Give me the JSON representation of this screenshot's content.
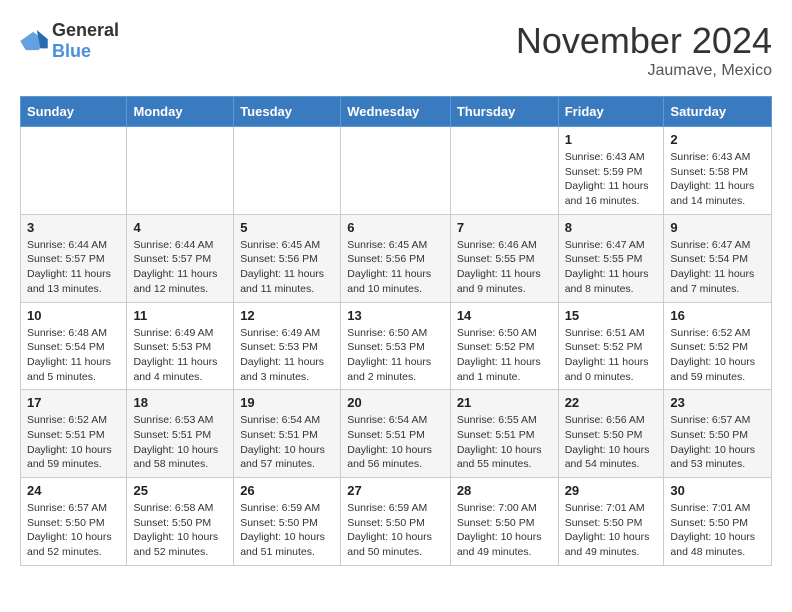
{
  "header": {
    "logo_general": "General",
    "logo_blue": "Blue",
    "month_title": "November 2024",
    "location": "Jaumave, Mexico"
  },
  "days_of_week": [
    "Sunday",
    "Monday",
    "Tuesday",
    "Wednesday",
    "Thursday",
    "Friday",
    "Saturday"
  ],
  "weeks": [
    [
      {
        "day": "",
        "info": ""
      },
      {
        "day": "",
        "info": ""
      },
      {
        "day": "",
        "info": ""
      },
      {
        "day": "",
        "info": ""
      },
      {
        "day": "",
        "info": ""
      },
      {
        "day": "1",
        "info": "Sunrise: 6:43 AM\nSunset: 5:59 PM\nDaylight: 11 hours\nand 16 minutes."
      },
      {
        "day": "2",
        "info": "Sunrise: 6:43 AM\nSunset: 5:58 PM\nDaylight: 11 hours\nand 14 minutes."
      }
    ],
    [
      {
        "day": "3",
        "info": "Sunrise: 6:44 AM\nSunset: 5:57 PM\nDaylight: 11 hours\nand 13 minutes."
      },
      {
        "day": "4",
        "info": "Sunrise: 6:44 AM\nSunset: 5:57 PM\nDaylight: 11 hours\nand 12 minutes."
      },
      {
        "day": "5",
        "info": "Sunrise: 6:45 AM\nSunset: 5:56 PM\nDaylight: 11 hours\nand 11 minutes."
      },
      {
        "day": "6",
        "info": "Sunrise: 6:45 AM\nSunset: 5:56 PM\nDaylight: 11 hours\nand 10 minutes."
      },
      {
        "day": "7",
        "info": "Sunrise: 6:46 AM\nSunset: 5:55 PM\nDaylight: 11 hours\nand 9 minutes."
      },
      {
        "day": "8",
        "info": "Sunrise: 6:47 AM\nSunset: 5:55 PM\nDaylight: 11 hours\nand 8 minutes."
      },
      {
        "day": "9",
        "info": "Sunrise: 6:47 AM\nSunset: 5:54 PM\nDaylight: 11 hours\nand 7 minutes."
      }
    ],
    [
      {
        "day": "10",
        "info": "Sunrise: 6:48 AM\nSunset: 5:54 PM\nDaylight: 11 hours\nand 5 minutes."
      },
      {
        "day": "11",
        "info": "Sunrise: 6:49 AM\nSunset: 5:53 PM\nDaylight: 11 hours\nand 4 minutes."
      },
      {
        "day": "12",
        "info": "Sunrise: 6:49 AM\nSunset: 5:53 PM\nDaylight: 11 hours\nand 3 minutes."
      },
      {
        "day": "13",
        "info": "Sunrise: 6:50 AM\nSunset: 5:53 PM\nDaylight: 11 hours\nand 2 minutes."
      },
      {
        "day": "14",
        "info": "Sunrise: 6:50 AM\nSunset: 5:52 PM\nDaylight: 11 hours\nand 1 minute."
      },
      {
        "day": "15",
        "info": "Sunrise: 6:51 AM\nSunset: 5:52 PM\nDaylight: 11 hours\nand 0 minutes."
      },
      {
        "day": "16",
        "info": "Sunrise: 6:52 AM\nSunset: 5:52 PM\nDaylight: 10 hours\nand 59 minutes."
      }
    ],
    [
      {
        "day": "17",
        "info": "Sunrise: 6:52 AM\nSunset: 5:51 PM\nDaylight: 10 hours\nand 59 minutes."
      },
      {
        "day": "18",
        "info": "Sunrise: 6:53 AM\nSunset: 5:51 PM\nDaylight: 10 hours\nand 58 minutes."
      },
      {
        "day": "19",
        "info": "Sunrise: 6:54 AM\nSunset: 5:51 PM\nDaylight: 10 hours\nand 57 minutes."
      },
      {
        "day": "20",
        "info": "Sunrise: 6:54 AM\nSunset: 5:51 PM\nDaylight: 10 hours\nand 56 minutes."
      },
      {
        "day": "21",
        "info": "Sunrise: 6:55 AM\nSunset: 5:51 PM\nDaylight: 10 hours\nand 55 minutes."
      },
      {
        "day": "22",
        "info": "Sunrise: 6:56 AM\nSunset: 5:50 PM\nDaylight: 10 hours\nand 54 minutes."
      },
      {
        "day": "23",
        "info": "Sunrise: 6:57 AM\nSunset: 5:50 PM\nDaylight: 10 hours\nand 53 minutes."
      }
    ],
    [
      {
        "day": "24",
        "info": "Sunrise: 6:57 AM\nSunset: 5:50 PM\nDaylight: 10 hours\nand 52 minutes."
      },
      {
        "day": "25",
        "info": "Sunrise: 6:58 AM\nSunset: 5:50 PM\nDaylight: 10 hours\nand 52 minutes."
      },
      {
        "day": "26",
        "info": "Sunrise: 6:59 AM\nSunset: 5:50 PM\nDaylight: 10 hours\nand 51 minutes."
      },
      {
        "day": "27",
        "info": "Sunrise: 6:59 AM\nSunset: 5:50 PM\nDaylight: 10 hours\nand 50 minutes."
      },
      {
        "day": "28",
        "info": "Sunrise: 7:00 AM\nSunset: 5:50 PM\nDaylight: 10 hours\nand 49 minutes."
      },
      {
        "day": "29",
        "info": "Sunrise: 7:01 AM\nSunset: 5:50 PM\nDaylight: 10 hours\nand 49 minutes."
      },
      {
        "day": "30",
        "info": "Sunrise: 7:01 AM\nSunset: 5:50 PM\nDaylight: 10 hours\nand 48 minutes."
      }
    ]
  ]
}
